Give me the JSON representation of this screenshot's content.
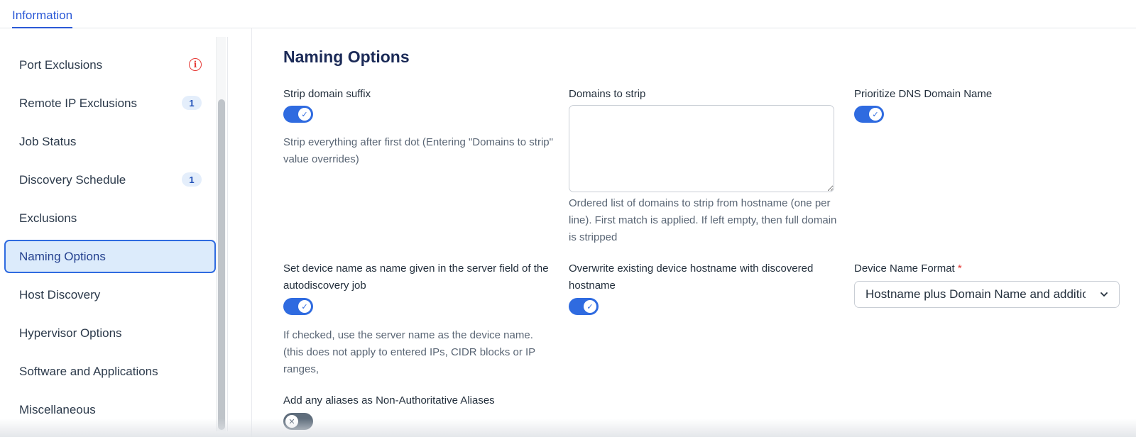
{
  "header": {
    "tab_label": "Information"
  },
  "sidebar": {
    "items": [
      {
        "label": "Port Exclusions",
        "indicator": "warning"
      },
      {
        "label": "Remote IP Exclusions",
        "badge": "1"
      },
      {
        "label": "Job Status"
      },
      {
        "label": "Discovery Schedule",
        "badge": "1"
      },
      {
        "label": "Exclusions"
      },
      {
        "label": "Naming Options",
        "active": true
      },
      {
        "label": "Host Discovery"
      },
      {
        "label": "Hypervisor Options"
      },
      {
        "label": "Software and Applications"
      },
      {
        "label": "Miscellaneous"
      }
    ]
  },
  "main": {
    "title": "Naming Options",
    "strip_suffix": {
      "label": "Strip domain suffix",
      "enabled": true,
      "help": "Strip everything after first dot (Entering \"Domains to strip\" value overrides)"
    },
    "domains_to_strip": {
      "label": "Domains to strip",
      "value": "",
      "help": "Ordered list of domains to strip from hostname (one per line). First match is applied. If left empty, then full domain is stripped"
    },
    "prioritize_dns": {
      "label": "Prioritize DNS Domain Name",
      "enabled": true
    },
    "server_name": {
      "label": "Set device name as name given in the server field of the autodiscovery job",
      "enabled": true,
      "help": "If checked, use the server name as the device name. (this does not apply to entered IPs, CIDR blocks or IP ranges,"
    },
    "overwrite_hostname": {
      "label": "Overwrite existing device hostname with discovered hostname",
      "enabled": true
    },
    "device_name_format": {
      "label": "Device Name Format",
      "required_mark": "*",
      "value": "Hostname plus Domain Name and additional"
    },
    "aliases": {
      "label": "Add any aliases as Non-Authoritative Aliases",
      "enabled": false
    }
  },
  "colors": {
    "accent": "#2f6be0",
    "active_bg": "#dcebfb",
    "title": "#1b2a57",
    "warning": "#e53935",
    "toggle_off": "#5f6d7c"
  },
  "icons": {
    "warning": "info-circle-icon",
    "toggle_on": "check-icon",
    "toggle_off": "x-icon",
    "select": "chevron-down-icon"
  }
}
